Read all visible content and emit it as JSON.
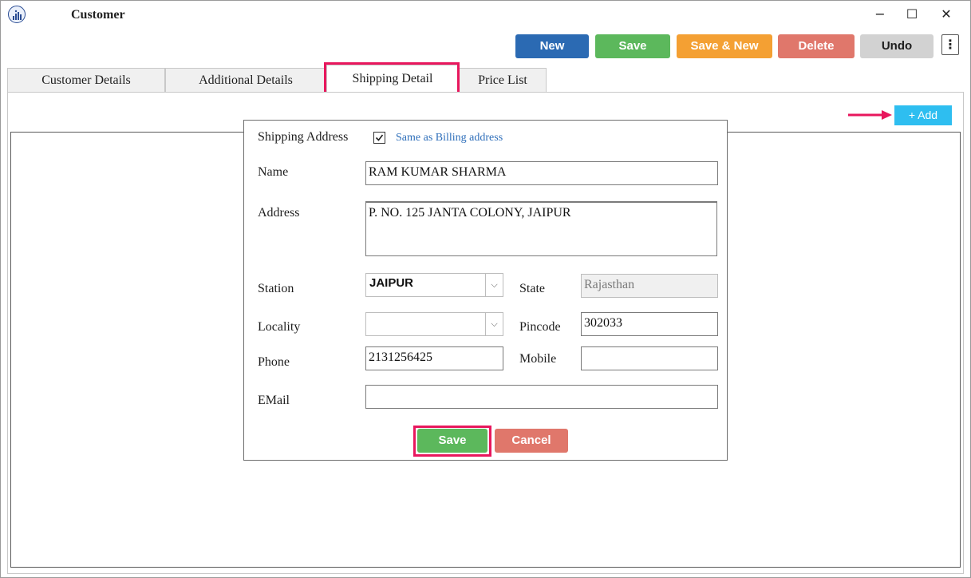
{
  "window": {
    "title": "Customer",
    "minimize": "−",
    "maximize": "☐",
    "close": "✕"
  },
  "toolbar": {
    "new_label": "New",
    "save_label": "Save",
    "save_new_label": "Save & New",
    "delete_label": "Delete",
    "undo_label": "Undo",
    "more_label": "⋮"
  },
  "tabs": [
    {
      "label": "Customer Details"
    },
    {
      "label": "Additional Details"
    },
    {
      "label": "Shipping Detail",
      "active": true
    },
    {
      "label": "Price List"
    }
  ],
  "grid": {
    "add_label": "+ Add"
  },
  "dialog": {
    "heading": "Shipping Address",
    "same_as_billing_label": "Same as Billing address",
    "same_as_billing_checked": true,
    "name_label": "Name",
    "name_value": "RAM KUMAR SHARMA",
    "address_label": "Address",
    "address_value": "P. NO. 125 JANTA COLONY, JAIPUR",
    "station_label": "Station",
    "station_value": "JAIPUR",
    "state_label": "State",
    "state_value": "Rajasthan",
    "locality_label": "Locality",
    "locality_value": "",
    "pincode_label": "Pincode",
    "pincode_value": "302033",
    "phone_label": "Phone",
    "phone_value": "2131256425",
    "mobile_label": "Mobile",
    "mobile_value": "",
    "email_label": "EMail",
    "email_value": "",
    "save_label": "Save",
    "cancel_label": "Cancel"
  },
  "colors": {
    "new": "#2b6ab3",
    "save": "#5cb85c",
    "save_new": "#f4a033",
    "delete": "#e0776b",
    "undo": "#d2d2d2",
    "add": "#2ebef0",
    "highlight": "#e8175d"
  },
  "icons": [
    "app-logo-icon",
    "checkbox-check-icon",
    "chevron-down-icon",
    "arrow-right-icon",
    "kebab-menu-icon"
  ]
}
